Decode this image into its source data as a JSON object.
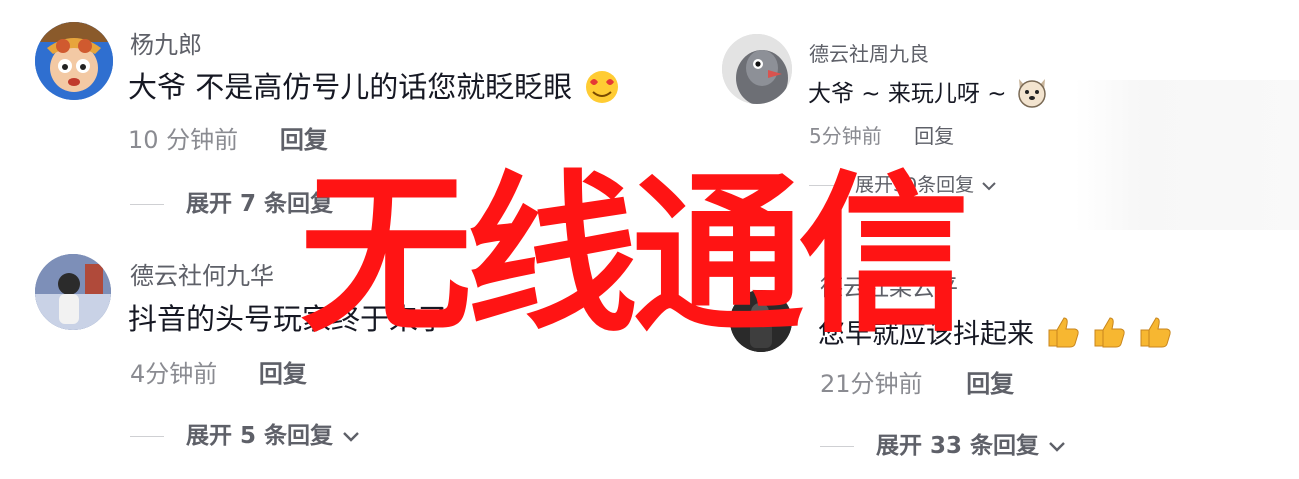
{
  "left_comments": [
    {
      "author": "杨九郎",
      "text": "大爷 不是高仿号儿的话您就眨眨眼",
      "emoji": "heart-eyes-emoji",
      "time": "10 分钟前",
      "reply": "回复",
      "expand": "展开 7 条回复"
    },
    {
      "author": "德云社何九华",
      "text": "抖音的头号玩家终于来了",
      "time": "4分钟前",
      "reply": "回复",
      "expand": "展开 5 条回复"
    }
  ],
  "right_comments": [
    {
      "author": "德云社周九良",
      "text": "大爷 ~ 来玩儿呀 ~",
      "emoji": "dog-face-emoji",
      "time": "5分钟前",
      "reply": "回复",
      "expand": "展开30条回复"
    },
    {
      "author": "德云社栾云平",
      "text": "您早就应该抖起来",
      "emoji": "thumbs-up-emoji",
      "time": "21分钟前",
      "reply": "回复",
      "expand": "展开 33 条回复"
    }
  ],
  "watermark": "无线通信",
  "colors": {
    "watermark": "#ff1414",
    "author": "#5e6068",
    "meta": "#8a8b91",
    "text": "#161823"
  }
}
